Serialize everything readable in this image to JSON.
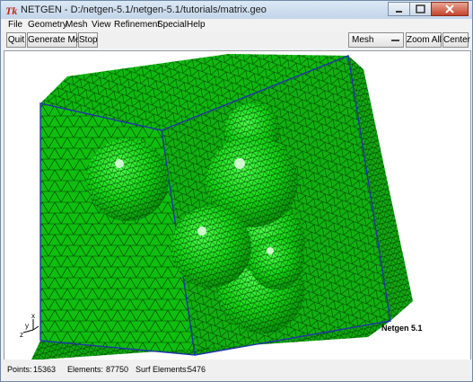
{
  "window": {
    "title": "NETGEN - D:/netgen-5.1/netgen-5.1/tutorials/matrix.geo"
  },
  "menu": {
    "items": [
      "File",
      "Geometry",
      "Mesh",
      "View",
      "Refinement",
      "Special",
      "Help"
    ]
  },
  "toolbar": {
    "quit_label": "Quit",
    "generate_mesh_label": "Generate Mesh",
    "stop_label": "Stop",
    "mode_select_value": "Mesh",
    "zoom_all_label": "Zoom All",
    "center_label": "Center"
  },
  "viewport": {
    "axis_x": "x",
    "axis_y": "y",
    "axis_z": "z",
    "version_text": "Netgen 5.1"
  },
  "status": {
    "points_label": "Points:",
    "points_value": "15363",
    "elements_label": "Elements:",
    "elements_value": "87750",
    "surf_elements_label": "Surf Elements:",
    "surf_elements_value": "5476"
  },
  "colors": {
    "mesh_green": "#00b400",
    "mesh_dark": "#004a00",
    "edge_blue": "#2233aa"
  },
  "icons": {
    "app": "tk-feather-icon"
  }
}
